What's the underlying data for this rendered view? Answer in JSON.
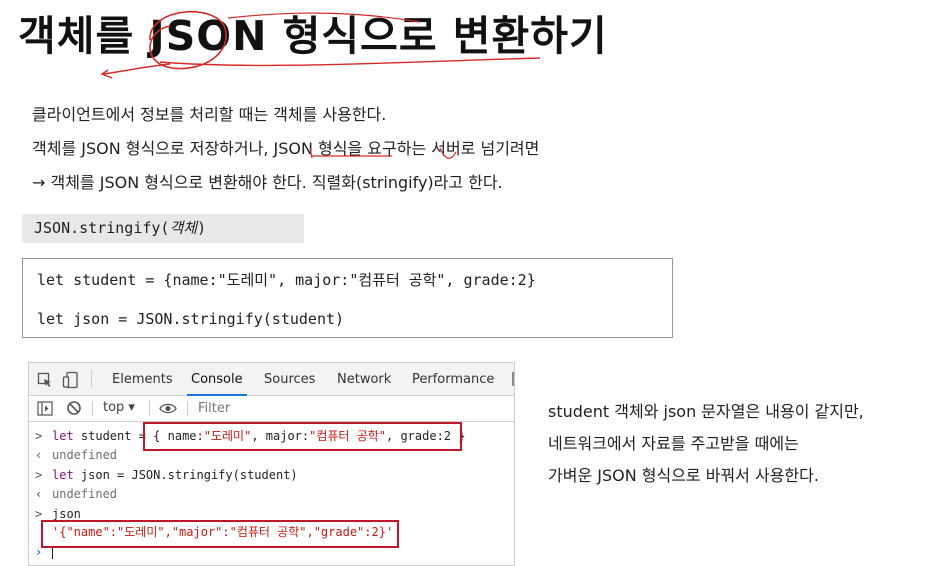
{
  "title": "객체를 JSON 형식으로 변환하기",
  "intro": {
    "line1": "클라이언트에서 정보를 처리할 때는 객체를 사용한다.",
    "line2": "객체를 JSON 형식으로 저장하거나, JSON 형식을 요구하는 서버로 넘기려면",
    "line3_arrow": "→",
    "line3": "객체를 JSON 형식으로 변환해야 한다. 직렬화(stringify)라고 한다."
  },
  "signature": {
    "prefix": "JSON.stringify(",
    "arg": "객체",
    "suffix": ")"
  },
  "code": {
    "line1": "let student = {name:\"도레미\", major:\"컴퓨터 공학\", grade:2}",
    "line2": "let json = JSON.stringify(student)"
  },
  "devtools": {
    "tabs": [
      "Elements",
      "Console",
      "Sources",
      "Network",
      "Performance"
    ],
    "active_tab": "Console",
    "context": "top ▾",
    "filter_placeholder": "Filter",
    "console": {
      "in1_kw": "let",
      "in1_name": " student = ",
      "in1_obj_open": "{ name:",
      "in1_name_val": "\"도레미\"",
      "in1_mid": ", major:",
      "in1_major_val": "\"컴퓨터 공학\"",
      "in1_end": ", grade:2 }",
      "out1": "undefined",
      "in2_kw": "let",
      "in2_rest": " json = JSON.stringify(student)",
      "out2": "undefined",
      "in3": "json",
      "out3": "'{\"name\":\"도레미\",\"major\":\"컴퓨터 공학\",\"grade\":2}'",
      "prompt_symbol": "›",
      "input_symbol": ">",
      "output_symbol": "‹"
    }
  },
  "side_note": {
    "line1": "student 객체와 json 문자열은 내용이 같지만,",
    "line2": "네트워크에서 자료를 주고받을 때에는",
    "line3": "가벼운 JSON 형식으로 바꿔서 사용한다."
  }
}
